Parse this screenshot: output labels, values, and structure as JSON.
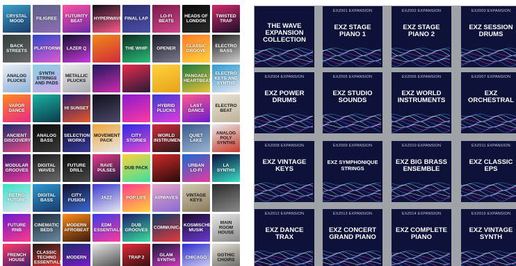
{
  "tiles": [
    {
      "t": "Crystal Mood",
      "bg": "linear-gradient(160deg,#3aa0c8,#1b3a6a)"
    },
    {
      "t": "Filigree",
      "bg": "linear-gradient(160deg,#5b5f8a,#8d6fb0)"
    },
    {
      "t": "Futurity Beat",
      "bg": "linear-gradient(160deg,#ff4fa3,#6b2aa8)"
    },
    {
      "t": "Hyperwave",
      "bg": "linear-gradient(160deg,#0e0e1c,#ff5b8a)"
    },
    {
      "t": "Final Lap",
      "bg": "linear-gradient(160deg,#2b2d6e,#4b4fa6)"
    },
    {
      "t": "Lo-Fi Beats",
      "bg": "linear-gradient(160deg,#7a1a4a,#d1458a)"
    },
    {
      "t": "Heads of London",
      "bg": "linear-gradient(160deg,#0a0a0a,#2a2a2a)"
    },
    {
      "t": "Twisted Trap",
      "bg": "linear-gradient(160deg,#d12a6a,#1a0e2a)"
    },
    {
      "t": "Back Streets",
      "bg": "linear-gradient(160deg,#2f3c3c,#6b6b6b)"
    },
    {
      "t": "Platformer",
      "bg": "linear-gradient(160deg,#2a47c9,#e35ad0)"
    },
    {
      "t": "Lazer Q",
      "bg": "linear-gradient(160deg,#0e0e2a,#c93ae0)"
    },
    {
      "t": "",
      "bg": "linear-gradient(160deg,#f08a1a,#d12a3a)"
    },
    {
      "t": "The Whip",
      "bg": "linear-gradient(160deg,#0a2a20,#2bbf7a)"
    },
    {
      "t": "Opener",
      "bg": "linear-gradient(160deg,#1a1a2a,#7a7a8a)"
    },
    {
      "t": "Classic Groove",
      "bg": "linear-gradient(160deg,#ff7a2a,#ffd23a)"
    },
    {
      "t": "Electro Bass",
      "bg": "linear-gradient(160deg,#1a1a1a,#d1d1d1)"
    },
    {
      "t": "Analog Plucks",
      "bg": "linear-gradient(160deg,#e9edf3,#8fb3d9)",
      "dark": true
    },
    {
      "t": "Synth Strings and Pads",
      "bg": "linear-gradient(160deg,#8ad1e6,#c9a6e6)",
      "dark": true
    },
    {
      "t": "Metallic Plucks",
      "bg": "linear-gradient(160deg,#e9e9ec,#a8a8b0)",
      "dark": true
    },
    {
      "t": "",
      "bg": "linear-gradient(160deg,#1a1a5a,#d12ab0)"
    },
    {
      "t": "",
      "bg": "linear-gradient(160deg,#e62a4a,#2a1a3a)"
    },
    {
      "t": "",
      "bg": "linear-gradient(160deg,#ffd23a,#e6a21a)",
      "dark": true
    },
    {
      "t": "Pangaea Heartbeat",
      "bg": "linear-gradient(160deg,#1a7a3a,#e6c23a)"
    },
    {
      "t": "Electro Keys and Synths",
      "bg": "linear-gradient(160deg,#2a9ad1,#e6e6f0)"
    },
    {
      "t": "Vapor Dance",
      "bg": "linear-gradient(160deg,#ff8a1a,#e62a8a)"
    },
    {
      "t": "",
      "bg": "linear-gradient(160deg,#1ab3a0,#0a3a4a)"
    },
    {
      "t": "Hi Sunset",
      "bg": "linear-gradient(160deg,#2a1a6a,#e65a2a)"
    },
    {
      "t": "",
      "bg": "linear-gradient(160deg,#0e0e1a,#4a4a6a)"
    },
    {
      "t": "",
      "bg": "linear-gradient(160deg,#8a1ad1,#ff3aa0)"
    },
    {
      "t": "Hybrid Plucks",
      "bg": "linear-gradient(160deg,#3a3ad1,#e63ae0)"
    },
    {
      "t": "Last Dance",
      "bg": "linear-gradient(160deg,#ff5a8a,#6a1ad1)"
    },
    {
      "t": "Electro Beat",
      "bg": "linear-gradient(160deg,#e9e3d6,#bfb29a)",
      "dark": true
    },
    {
      "t": "Ancient Discovery",
      "bg": "linear-gradient(160deg,#1a2a6a,#e64a8a)"
    },
    {
      "t": "Analog Bass",
      "bg": "linear-gradient(160deg,#0a0a0a,#3a3a3a)"
    },
    {
      "t": "Selection Works",
      "bg": "linear-gradient(160deg,#0e0e2a,#3a3a9a)"
    },
    {
      "t": "Movement Pack",
      "bg": "linear-gradient(160deg,#f0a63a,#e6e6e6)",
      "dark": true
    },
    {
      "t": "City Stories",
      "bg": "linear-gradient(160deg,#2a2ae6,#e64ad1)"
    },
    {
      "t": "World Instruments",
      "bg": "linear-gradient(160deg,#d12a3a,#2a1a1a)"
    },
    {
      "t": "Quiet Lake",
      "bg": "linear-gradient(160deg,#3a5a8a,#9ab3d1)"
    },
    {
      "t": "Analog Poly Synths",
      "bg": "linear-gradient(160deg,#e9e9e9,#c93a2a)",
      "dark": true
    },
    {
      "t": "Modular Grooves",
      "bg": "linear-gradient(160deg,#3a1a6a,#e63aa0)"
    },
    {
      "t": "Digital Waves",
      "bg": "linear-gradient(160deg,#1a1a1a,#6a6a6a)"
    },
    {
      "t": "Future Drill",
      "bg": "linear-gradient(160deg,#0a0a0a,#4a4a4a)"
    },
    {
      "t": "Rave Pulses",
      "bg": "linear-gradient(160deg,#e63a8a,#1a1a3a)"
    },
    {
      "t": "Dub Pack",
      "bg": "linear-gradient(160deg,#ffd23a,#3ae0a0)",
      "dark": true
    },
    {
      "t": "",
      "bg": "linear-gradient(160deg,#d12a2a,#2a0a0a)"
    },
    {
      "t": "Urban Lo-Fi",
      "bg": "linear-gradient(160deg,#1a6ad1,#e63aa0)"
    },
    {
      "t": "LA Synths",
      "bg": "linear-gradient(160deg,#0a0a3a,#3ae0c9)"
    },
    {
      "t": "Retro Future",
      "bg": "linear-gradient(160deg,#3ae0c9,#e6e6f0)"
    },
    {
      "t": "Digital Bass",
      "bg": "linear-gradient(160deg,#2a9ad1,#1a3a6a)"
    },
    {
      "t": "City Fusion",
      "bg": "linear-gradient(160deg,#0e0e2a,#3a6ad1)"
    },
    {
      "t": "Jazz",
      "bg": "linear-gradient(160deg,#3a3ad1,#e6e6f0)"
    },
    {
      "t": "Pop Life",
      "bg": "linear-gradient(160deg,#ff3a8a,#ffd23a)"
    },
    {
      "t": "Airwaves",
      "bg": "linear-gradient(160deg,#e6a6c9,#8a6ad1)"
    },
    {
      "t": "Vintage Keys",
      "bg": "linear-gradient(160deg,#d1c9b3,#8a7a5a)",
      "dark": true
    },
    {
      "t": "",
      "bg": "linear-gradient(160deg,#2a2a2a,#8a8a8a)"
    },
    {
      "t": "Future RnB",
      "bg": "linear-gradient(160deg,#6a1ad1,#ff3a8a)"
    },
    {
      "t": "Cinematic Beds",
      "bg": "linear-gradient(160deg,#1a2a3a,#6a8aa0)"
    },
    {
      "t": "Modern Afrobeat",
      "bg": "linear-gradient(160deg,#ff8a1a,#3a1a0a)"
    },
    {
      "t": "EDM Essentials",
      "bg": "linear-gradient(160deg,#3a3ae6,#ff3aa0)"
    },
    {
      "t": "Dub Grooves",
      "bg": "linear-gradient(160deg,#1a1a6a,#3ae0a0)"
    },
    {
      "t": "Communication",
      "bg": "linear-gradient(160deg,#0a3a6a,#e63a3a)"
    },
    {
      "t": "Kosmische Musik",
      "bg": "linear-gradient(160deg,#1a0a2a,#6a3ad1)"
    },
    {
      "t": "Main Room House",
      "bg": "linear-gradient(160deg,#e6e6e6,#8a8a8a)",
      "dark": true
    },
    {
      "t": "French House",
      "bg": "linear-gradient(160deg,#ff3a6a,#2a1a6a)"
    },
    {
      "t": "Classic Techno Essentials",
      "bg": "linear-gradient(160deg,#1a1a1a,#ff3a3a)"
    },
    {
      "t": "Modern",
      "bg": "linear-gradient(160deg,#1a2a6a,#8a1ad1)"
    },
    {
      "t": "",
      "bg": "linear-gradient(160deg,#e6e6e6,#3a3a3a)"
    },
    {
      "t": "Trap 2",
      "bg": "linear-gradient(160deg,#e62a3a,#1a0a0a)"
    },
    {
      "t": "Glam Synths",
      "bg": "linear-gradient(160deg,#1a1a3a,#e63ad1)"
    },
    {
      "t": "Chicago",
      "bg": "linear-gradient(160deg,#2a2ad1,#e6e6f0)"
    },
    {
      "t": "Gothic Choirs",
      "bg": "linear-gradient(160deg,#e9e3d6,#5a5a5a)",
      "dark": true
    }
  ],
  "expansions": [
    {
      "tag": "",
      "name": "The Wave Expansion Collection",
      "col": 0,
      "row": 0
    },
    {
      "tag": "EXZ001 EXPANSION",
      "name": "EXZ Stage Piano 1",
      "col": 1,
      "row": 0
    },
    {
      "tag": "EXZ002 EXPANSION",
      "name": "EXZ Stage Piano 2",
      "col": 2,
      "row": 0
    },
    {
      "tag": "EXZ003 EXPANSION",
      "name": "EXZ Session Drums",
      "col": 3,
      "row": 0
    },
    {
      "tag": "EXZ004 EXPANSION",
      "name": "EXZ Power Drums",
      "col": 0,
      "row": 1
    },
    {
      "tag": "EXZ005 EXPANSION",
      "name": "EXZ Studio Sounds",
      "col": 1,
      "row": 1
    },
    {
      "tag": "EXZ006 EXPANSION",
      "name": "EXZ World Instruments",
      "col": 2,
      "row": 1
    },
    {
      "tag": "EXZ007 EXPANSION",
      "name": "EXZ Orchestral",
      "col": 3,
      "row": 1
    },
    {
      "tag": "EXZ008 EXPANSION",
      "name": "EXZ Vintage Keys",
      "col": 0,
      "row": 2
    },
    {
      "tag": "EXZ009 EXPANSION",
      "name": "EXZ Symphonique Strings",
      "col": 1,
      "row": 2,
      "small": true
    },
    {
      "tag": "EXZ010 EXPANSION",
      "name": "EXZ Big Brass Ensemble",
      "col": 2,
      "row": 2
    },
    {
      "tag": "EXZ011 EXPANSION",
      "name": "EXZ Classic EPs",
      "col": 3,
      "row": 2
    },
    {
      "tag": "EXZ012 EXPANSION",
      "name": "EXZ Dance Trax",
      "col": 0,
      "row": 3
    },
    {
      "tag": "EXZ013 EXPANSION",
      "name": "EXZ Concert Grand Piano",
      "col": 1,
      "row": 3
    },
    {
      "tag": "EXZ014 EXPANSION",
      "name": "EXZ Complete Piano",
      "col": 2,
      "row": 3
    },
    {
      "tag": "EXZ015 EXPANSION",
      "name": "EXZ Vintage Synth",
      "col": 3,
      "row": 3
    }
  ],
  "wave_colors": [
    "#3a8ae6",
    "#9ad1ff",
    "#e6f0ff",
    "#c93ad1"
  ]
}
